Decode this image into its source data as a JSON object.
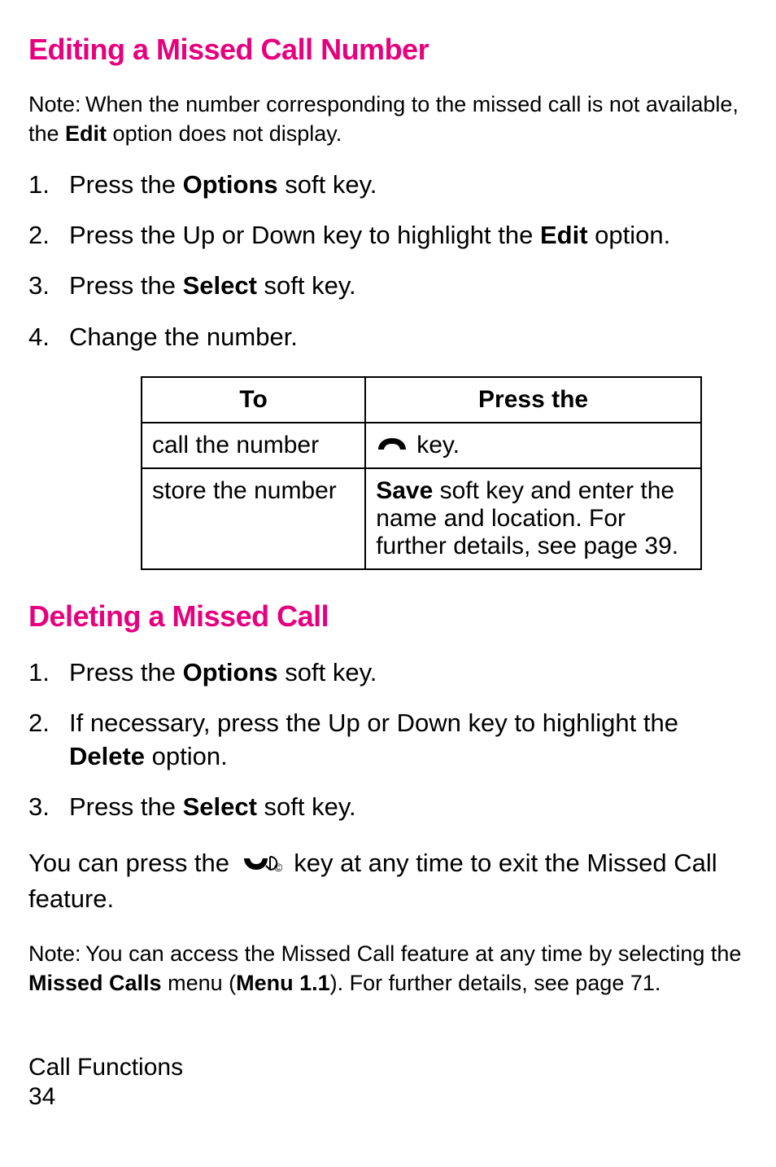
{
  "section1": {
    "heading": "Editing a Missed Call Number",
    "note_prefix": "Note: ",
    "note_text1": "When the number corresponding to the missed call is not available, the ",
    "note_bold": "Edit",
    "note_text2": " option does not display.",
    "steps": [
      {
        "num": "1.",
        "pre": "Press the ",
        "bold": "Options",
        "post": " soft key."
      },
      {
        "num": "2.",
        "pre": "Press the Up or Down key to highlight the ",
        "bold": "Edit",
        "post": " option."
      },
      {
        "num": "3.",
        "pre": "Press the ",
        "bold": "Select",
        "post": " soft key."
      },
      {
        "num": "4.",
        "pre": "Change the number.",
        "bold": "",
        "post": ""
      }
    ]
  },
  "table": {
    "header_to": "To",
    "header_press": "Press the",
    "row1_to": "call the number",
    "row1_icon": "call-key",
    "row1_press": " key.",
    "row2_to": "store the number",
    "row2_bold": "Save",
    "row2_text": " soft key and enter the name and location. For further details, see page 39."
  },
  "section2": {
    "heading": "Deleting a Missed Call",
    "steps": [
      {
        "num": "1.",
        "pre": "Press the ",
        "bold": "Options",
        "post": " soft key."
      },
      {
        "num": "2.",
        "pre": "If necessary, press the Up or Down key to highlight the ",
        "bold": "Delete",
        "post": " option."
      },
      {
        "num": "3.",
        "pre": "Press the ",
        "bold": "Select",
        "post": " soft key."
      }
    ],
    "body_pre": "You can press the ",
    "body_post": " key at any time to exit the Missed Call feature.",
    "note2_prefix": "Note: ",
    "note2_text1": "You can access the Missed Call feature at any time by selecting the ",
    "note2_bold1": "Missed Calls",
    "note2_text2": " menu (",
    "note2_bold2": "Menu 1.1",
    "note2_text3": "). For further details, see page 71."
  },
  "footer": {
    "chapter": "Call Functions",
    "page": " 34"
  }
}
